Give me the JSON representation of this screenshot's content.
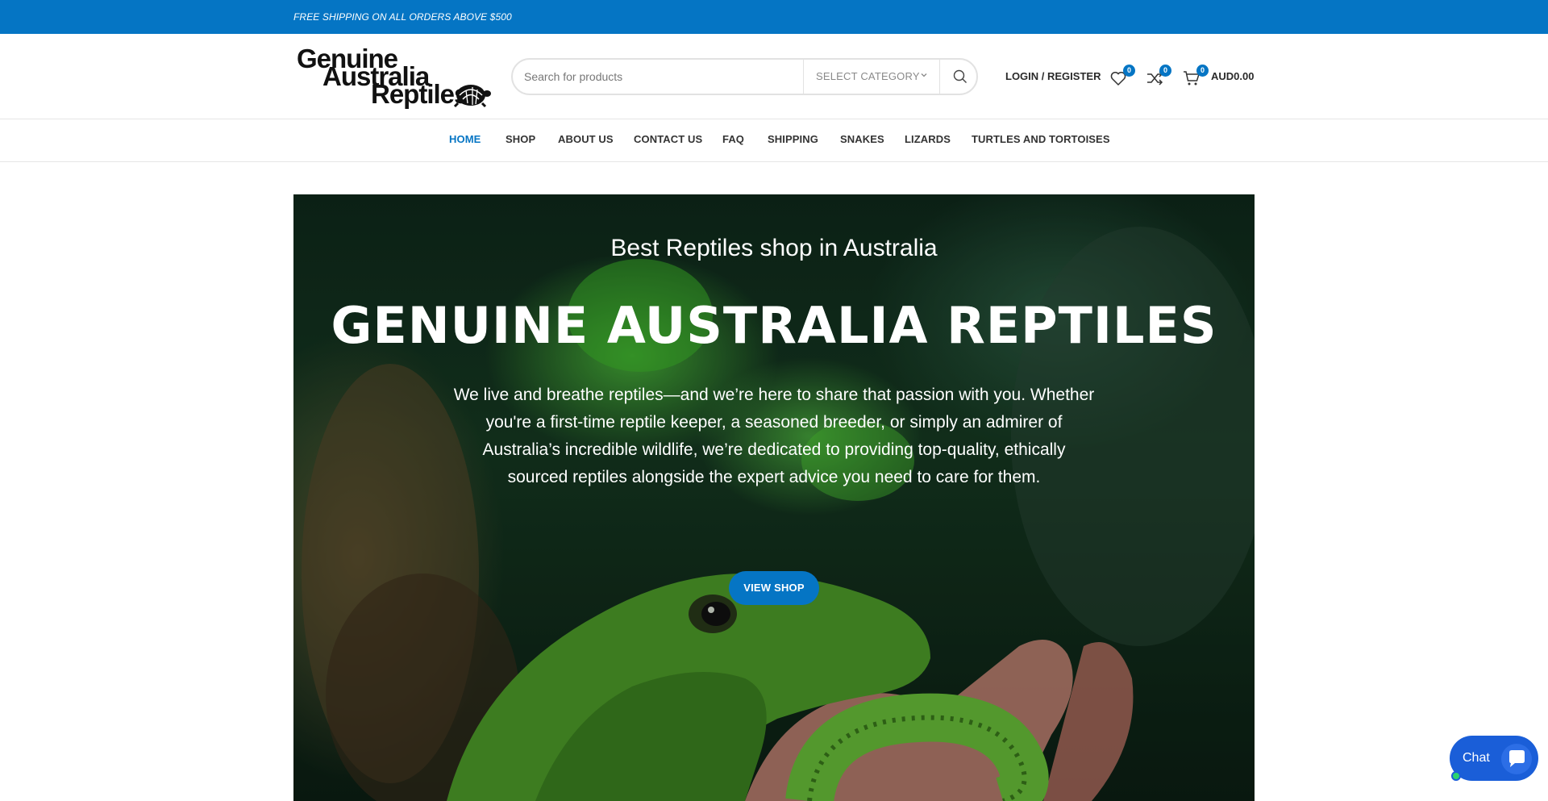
{
  "topbar": {
    "text": "FREE SHIPPING ON ALL ORDERS ABOVE $500"
  },
  "brand": {
    "logo_lines": [
      "Genuine",
      "Australia",
      "Reptiles"
    ],
    "accent": "#0575c4"
  },
  "search": {
    "placeholder": "Search for products",
    "category_label": "SELECT CATEGORY",
    "icon": "search-icon"
  },
  "header": {
    "login_label": "LOGIN / REGISTER",
    "wishlist_count": "0",
    "compare_count": "0",
    "cart_count": "0",
    "cart_total": "AUD0.00"
  },
  "nav": {
    "items": [
      {
        "label": "HOME",
        "active": true
      },
      {
        "label": "SHOP"
      },
      {
        "label": "ABOUT US"
      },
      {
        "label": "CONTACT US"
      },
      {
        "label": "FAQ"
      },
      {
        "label": "SHIPPING"
      },
      {
        "label": "SNAKES"
      },
      {
        "label": "LIZARDS"
      },
      {
        "label": "TURTLES AND TORTOISES"
      }
    ]
  },
  "hero": {
    "subtitle": "Best Reptiles shop in Australia",
    "title": "GENUINE AUSTRALIA REPTILES",
    "body": "We live and breathe reptiles—and we’re here to share that passion with you. Whether you're a first-time reptile keeper, a seasoned breeder, or simply an admirer of Australia’s incredible wildlife, we’re dedicated to providing top-quality, ethically sourced reptiles alongside the expert advice you need to care for them.",
    "button_label": "VIEW SHOP"
  },
  "chat": {
    "label": "Chat"
  }
}
